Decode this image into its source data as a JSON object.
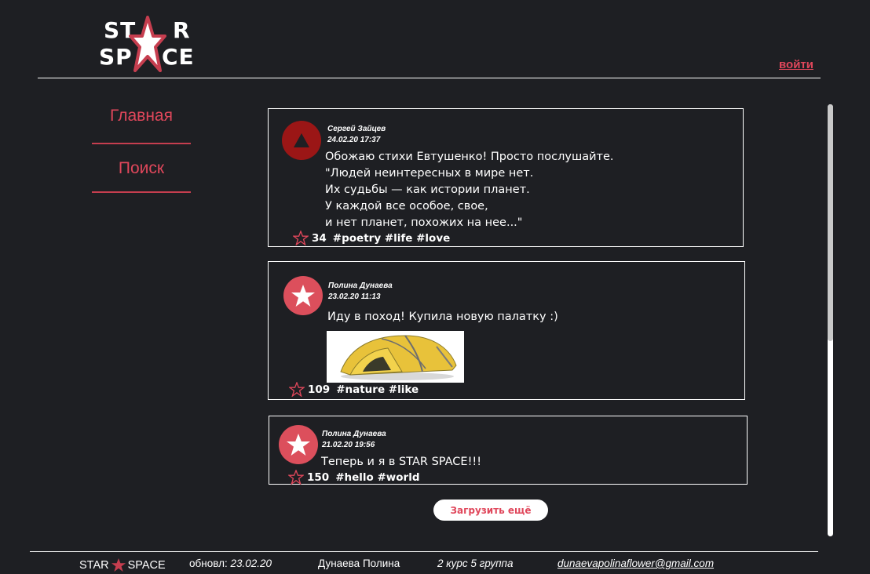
{
  "header": {
    "logo_line1_left": "ST",
    "logo_line1_right": "R",
    "logo_line2_left": "SP",
    "logo_line2_right": "CE",
    "login_label": "войти"
  },
  "sidebar": {
    "items": [
      {
        "label": "Главная"
      },
      {
        "label": "Поиск"
      }
    ]
  },
  "posts": [
    {
      "author": "Сергей Зайцев",
      "date": "24.02.20 17:37",
      "avatar_icon": "triangle-icon",
      "text": "Обожаю стихи Евтушенко! Просто послушайте.\n\"Людей неинтересных в мире нет.\nИх судьбы — как истории планет.\nУ каждой все особое, свое,\nи нет планет, похожих на нее...\"",
      "stars": "34",
      "tags": "#poetry #life #love"
    },
    {
      "author": "Полина Дунаева",
      "date": "23.02.20 11:13",
      "avatar_icon": "star-icon",
      "text": "Иду в поход! Купила новую палатку :)",
      "stars": "109",
      "tags": "#nature #like"
    },
    {
      "author": "Полина Дунаева",
      "date": "21.02.20 19:56",
      "avatar_icon": "star-icon",
      "text": "Теперь и я в STAR SPACE!!!",
      "stars": "150",
      "tags": "#hello #world"
    }
  ],
  "load_more_label": "Загрузить ещё",
  "footer": {
    "logo_left": "STAR",
    "logo_right": "SPACE",
    "updated_label": "обновл:",
    "updated_date": "23.02.20",
    "author_name": "Дунаева Полина",
    "group": "2 курс 5 группа",
    "email": "dunaevapolinaflower@gmail.com"
  },
  "colors": {
    "background": "#1e1f23",
    "accent": "#e0475b",
    "dark_avatar": "#9b1616"
  }
}
